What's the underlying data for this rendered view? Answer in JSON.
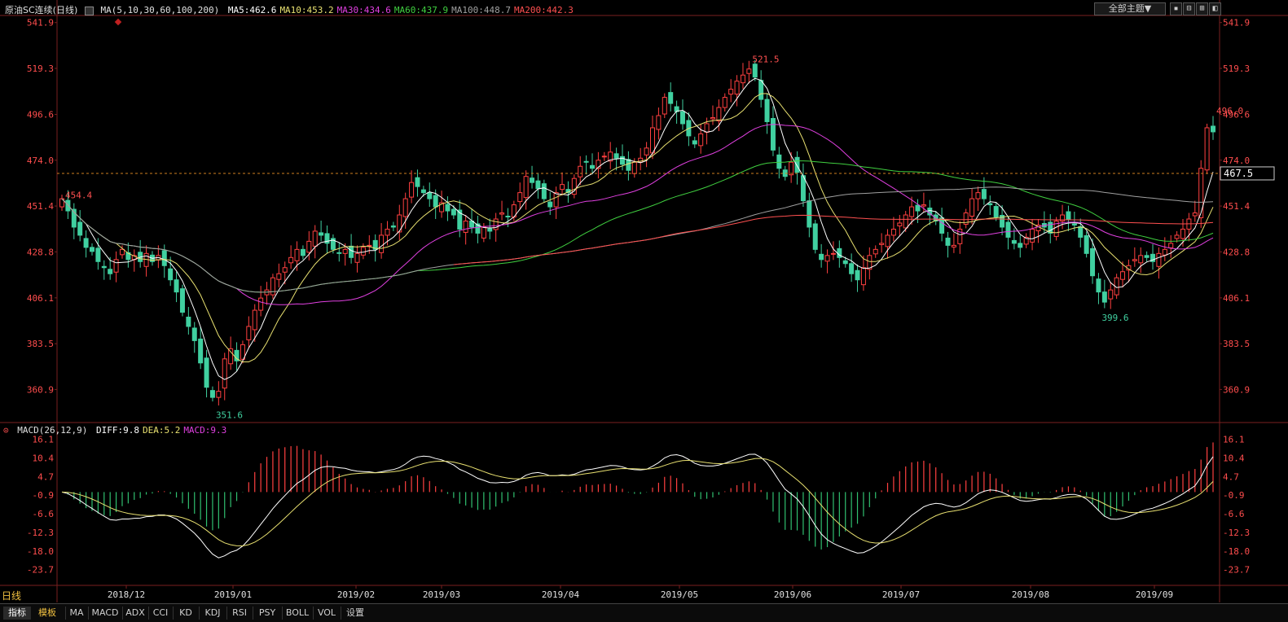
{
  "header": {
    "instrument": "原油SC连续(日线)",
    "ma_spec": "MA(5,10,30,60,100,200)",
    "ma_values": [
      {
        "text": "MA5:462.6",
        "color": "#ffffff"
      },
      {
        "text": "MA10:453.2",
        "color": "#e8e070"
      },
      {
        "text": "MA30:434.6",
        "color": "#e040e0"
      },
      {
        "text": "MA60:437.9",
        "color": "#40d040"
      },
      {
        "text": "MA100:448.7",
        "color": "#a0a0a0"
      },
      {
        "text": "MA200:442.3",
        "color": "#ff5050"
      }
    ],
    "theme_button": "全部主题▼",
    "window_buttons": [
      "▪",
      "⊟",
      "⊞",
      "◧"
    ]
  },
  "macd_header": {
    "spec": "MACD(26,12,9)",
    "values": [
      {
        "text": "DIFF:9.8",
        "color": "#ffffff"
      },
      {
        "text": "DEA:5.2",
        "color": "#e8e070"
      },
      {
        "text": "MACD:9.3",
        "color": "#e040e0"
      }
    ]
  },
  "period_label": "日线",
  "bottom_tabs": [
    "指标",
    "模板",
    "MA",
    "MACD",
    "ADX",
    "CCI",
    "KD",
    "KDJ",
    "RSI",
    "PSY",
    "BOLL",
    "VOL",
    "设置"
  ],
  "colors": {
    "up": "#ff4040",
    "down": "#40d0a0",
    "grid": "#7a1f1f",
    "axis_text_up": "#ff4d4d",
    "axis_text_macd": "#ff4d4d"
  },
  "chart_data": [
    {
      "type": "candlestick",
      "title": "原油SC连续(日线)",
      "ylim": [
        345.0,
        545.0
      ],
      "y_ticks": [
        541.9,
        519.3,
        496.6,
        474.0,
        451.4,
        428.8,
        406.1,
        383.5,
        360.9
      ],
      "x_tick_labels": [
        "2018/12",
        "2019/01",
        "2019/02",
        "2019/03",
        "2019/04",
        "2019/05",
        "2019/06",
        "2019/07",
        "2019/08",
        "2019/09"
      ],
      "current_price": 467.5,
      "annotations": [
        {
          "text": "454.4",
          "value": 454.4,
          "kind": "high"
        },
        {
          "text": "351.6",
          "value": 351.6,
          "kind": "low"
        },
        {
          "text": "521.5",
          "value": 521.5,
          "kind": "high"
        },
        {
          "text": "399.6",
          "value": 399.6,
          "kind": "low"
        },
        {
          "text": "496.0",
          "value": 496.0,
          "kind": "high"
        }
      ],
      "series": [
        {
          "name": "MA5",
          "color": "#ffffff"
        },
        {
          "name": "MA10",
          "color": "#e8e070"
        },
        {
          "name": "MA30",
          "color": "#e040e0"
        },
        {
          "name": "MA60",
          "color": "#40d040"
        },
        {
          "name": "MA100",
          "color": "#a0a0a0"
        },
        {
          "name": "MA200",
          "color": "#ff5050"
        }
      ],
      "closes": [
        455,
        449,
        441,
        437,
        431,
        429,
        424,
        421,
        418,
        425,
        430,
        425,
        427,
        424,
        428,
        424,
        427,
        422,
        415,
        409,
        399,
        392,
        385,
        374,
        362,
        357,
        360,
        376,
        381,
        375,
        383,
        392,
        400,
        406,
        410,
        416,
        418,
        421,
        426,
        430,
        427,
        434,
        439,
        437,
        433,
        430,
        428,
        430,
        426,
        428,
        431,
        432,
        430,
        437,
        440,
        441,
        447,
        455,
        463,
        461,
        458,
        455,
        451,
        453,
        449,
        447,
        440,
        444,
        441,
        438,
        441,
        439,
        445,
        448,
        446,
        452,
        458,
        466,
        463,
        460,
        455,
        451,
        458,
        462,
        458,
        465,
        471,
        473,
        470,
        474,
        476,
        478,
        475,
        472,
        469,
        473,
        475,
        480,
        490,
        496,
        505,
        502,
        498,
        492,
        486,
        482,
        487,
        492,
        495,
        500,
        505,
        509,
        513,
        516,
        519,
        515,
        504,
        493,
        479,
        470,
        466,
        473,
        468,
        454,
        441,
        430,
        425,
        427,
        428,
        426,
        423,
        418,
        415,
        421,
        427,
        430,
        433,
        437,
        440,
        443,
        447,
        451,
        449,
        452,
        447,
        444,
        438,
        432,
        432,
        440,
        448,
        455,
        458,
        455,
        452,
        446,
        441,
        436,
        433,
        431,
        436,
        440,
        442,
        441,
        438,
        444,
        447,
        445,
        442,
        436,
        428,
        417,
        409,
        404,
        410,
        416,
        419,
        422,
        425,
        427,
        426,
        424,
        428,
        430,
        433,
        437,
        440,
        445,
        448,
        470,
        490,
        488
      ]
    },
    {
      "type": "bar+line",
      "title": "MACD(26,12,9)",
      "ylim": [
        -28.0,
        18.5
      ],
      "y_ticks": [
        16.1,
        10.4,
        4.7,
        -0.9,
        -6.6,
        -12.3,
        -18.0,
        -23.7
      ],
      "series": [
        {
          "name": "DIFF",
          "color": "#ffffff",
          "last": 9.8
        },
        {
          "name": "DEA",
          "color": "#e8e070",
          "last": 5.2
        },
        {
          "name": "MACD",
          "color": "#e040e0",
          "last": 9.3
        }
      ]
    }
  ]
}
